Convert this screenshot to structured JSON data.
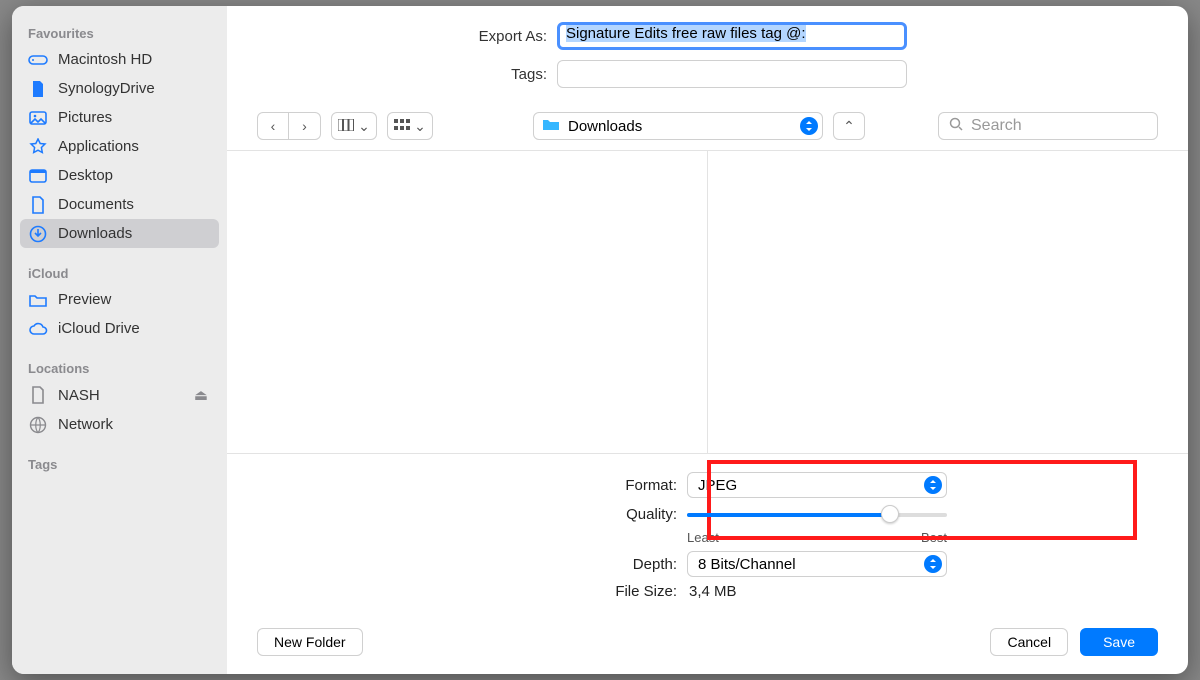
{
  "header": {
    "exportas_label": "Export As:",
    "filename": "Signature Edits free raw files tag @:",
    "tags_label": "Tags:",
    "tags_value": ""
  },
  "sidebar": {
    "sections": [
      {
        "title": "Favourites"
      },
      {
        "title": "iCloud"
      },
      {
        "title": "Locations"
      },
      {
        "title": "Tags"
      }
    ],
    "favourites": [
      {
        "icon": "disk",
        "label": "Macintosh HD"
      },
      {
        "icon": "doc",
        "label": "SynologyDrive"
      },
      {
        "icon": "image",
        "label": "Pictures"
      },
      {
        "icon": "app",
        "label": "Applications"
      },
      {
        "icon": "desktop",
        "label": "Desktop"
      },
      {
        "icon": "docoutline",
        "label": "Documents"
      },
      {
        "icon": "download",
        "label": "Downloads"
      }
    ],
    "icloud": [
      {
        "icon": "folder",
        "label": "Preview"
      },
      {
        "icon": "cloud",
        "label": "iCloud Drive"
      }
    ],
    "locations": [
      {
        "icon": "docoutline",
        "label": "NASH",
        "eject": true
      },
      {
        "icon": "globe",
        "label": "Network"
      }
    ]
  },
  "toolbar": {
    "location": "Downloads",
    "search_placeholder": "Search"
  },
  "options": {
    "format_label": "Format:",
    "format_value": "JPEG",
    "quality_label": "Quality:",
    "quality_min": "Least",
    "quality_max": "Best",
    "depth_label": "Depth:",
    "depth_value": "8 Bits/Channel",
    "filesize_label": "File Size:",
    "filesize_value": "3,4 MB"
  },
  "footer": {
    "newfolder": "New Folder",
    "cancel": "Cancel",
    "save": "Save"
  }
}
